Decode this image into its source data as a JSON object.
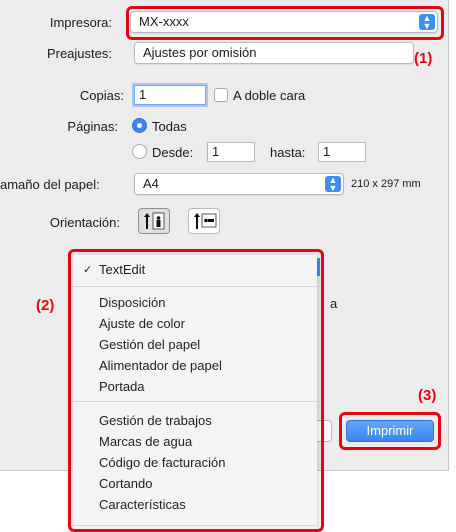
{
  "printer": {
    "label": "Impresora:",
    "value": "MX-xxxx"
  },
  "presets": {
    "label": "Preajustes:",
    "value": "Ajustes por omisión"
  },
  "copies": {
    "label": "Copias:",
    "value": "1",
    "duplex_label": "A doble cara"
  },
  "pages": {
    "label": "Páginas:",
    "all_label": "Todas",
    "from_label": "Desde:",
    "from_value": "1",
    "to_label": "hasta:",
    "to_value": "1"
  },
  "paper_size": {
    "label": "amaño del papel:",
    "value": "A4",
    "dimensions": "210 x 297 mm"
  },
  "orientation": {
    "label": "Orientación:"
  },
  "menu": {
    "selected": "TextEdit",
    "group1": [
      "Disposición",
      "Ajuste de color",
      "Gestión del papel",
      "Alimentador de papel",
      "Portada"
    ],
    "group2": [
      "Gestión de trabajos",
      "Marcas de agua",
      "Código de facturación",
      "Cortando",
      "Características"
    ]
  },
  "behind_menu_text": "a",
  "print_button": "Imprimir",
  "callouts": {
    "one": "(1)",
    "two": "(2)",
    "three": "(3)"
  },
  "colors": {
    "accent": "#3f8ef5",
    "callout_red": "#e30613"
  }
}
